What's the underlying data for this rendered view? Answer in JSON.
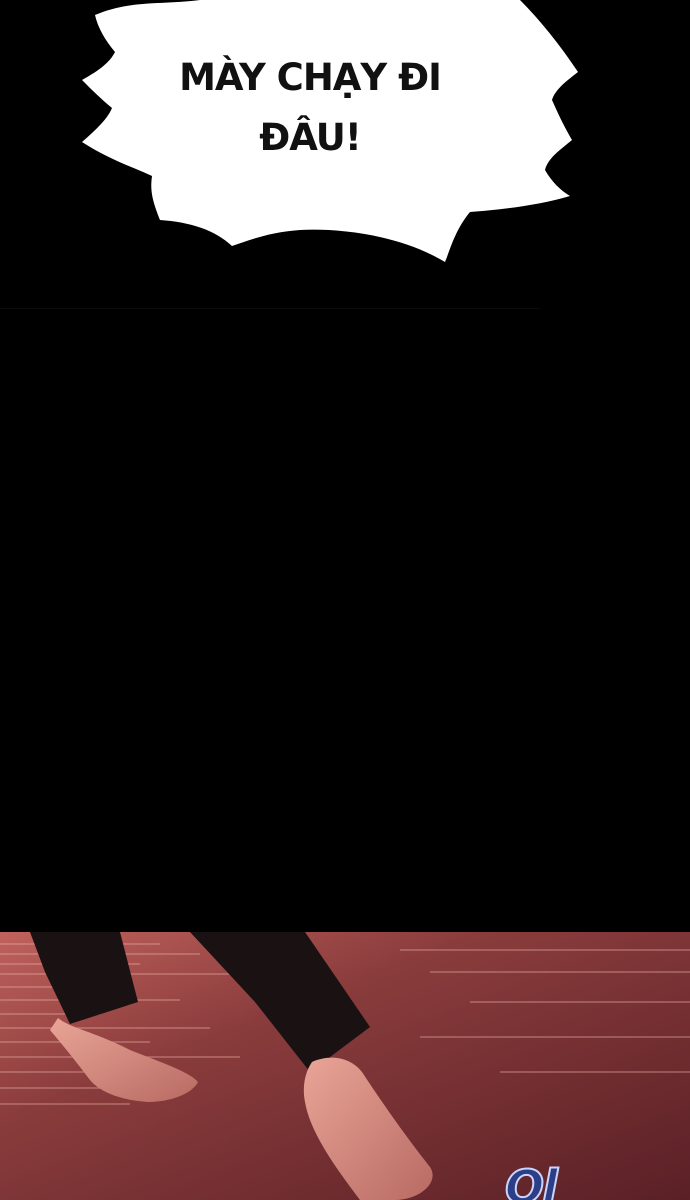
{
  "speech_bubble": {
    "lines": [
      "MÀY CHẠY ĐI",
      "ĐÂU!"
    ]
  },
  "sound_effect": {
    "text": "Ol"
  },
  "colors": {
    "background": "#000000",
    "bubble_fill": "#ffffff",
    "floor": "#7a3333",
    "floor_highlight": "#b85552",
    "pants": "#1a1112",
    "skin": "#d98f84",
    "sfx_fill": "#2c3e86"
  }
}
